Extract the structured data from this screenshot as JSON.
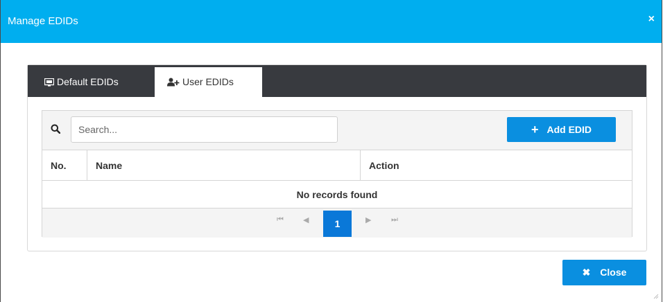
{
  "dialog": {
    "title": "Manage EDIDs",
    "close_icon_glyph": "×"
  },
  "tabs": [
    {
      "label": "Default EDIDs",
      "icon": "monitor-icon",
      "active": false
    },
    {
      "label": "User EDIDs",
      "icon": "user-add-icon",
      "active": true
    }
  ],
  "search": {
    "placeholder": "Search...",
    "value": ""
  },
  "add_button": {
    "label": "Add EDID",
    "icon": "plus-icon"
  },
  "table": {
    "columns": [
      "No.",
      "Name",
      "Action"
    ],
    "empty_message": "No records found"
  },
  "pagination": {
    "current_page": "1",
    "first_glyph": "⏮",
    "prev_glyph": "◀",
    "next_glyph": "▶",
    "last_glyph": "⏭"
  },
  "footer": {
    "close_label": "Close",
    "close_icon": "times-icon"
  },
  "colors": {
    "titlebar": "#00aeef",
    "tabbar": "#383a3f",
    "primary_button": "#0a8fe0",
    "active_page": "#0a78d8"
  }
}
